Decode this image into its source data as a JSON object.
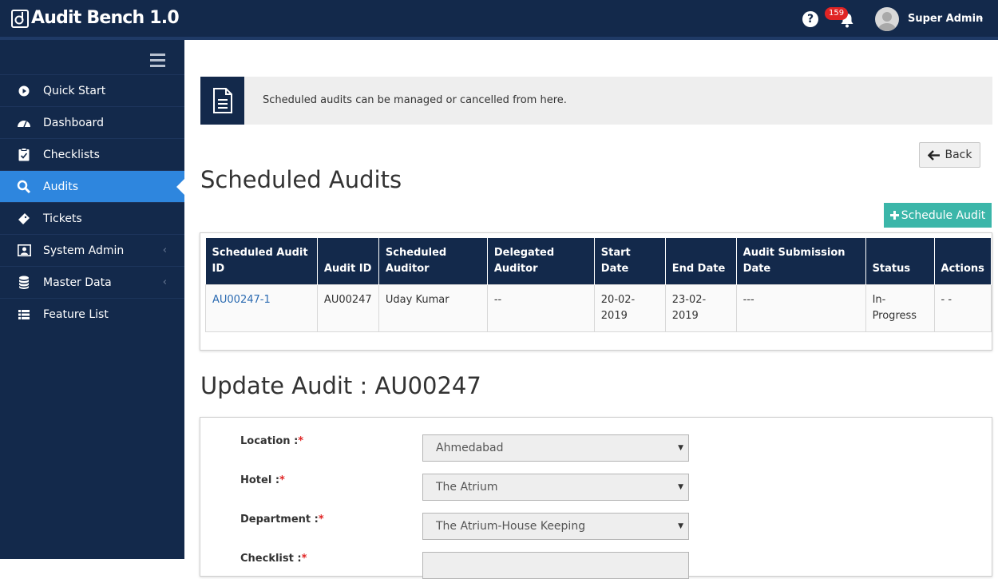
{
  "app": {
    "title": "Audit Bench 1.0"
  },
  "header": {
    "help_icon": "?",
    "notifications_count": "159",
    "user_name": "Super Admin",
    "user_caret": "⌄"
  },
  "sidebar": {
    "items": [
      {
        "label": "Quick Start",
        "icon": "play-circle-icon"
      },
      {
        "label": "Dashboard",
        "icon": "dashboard-icon"
      },
      {
        "label": "Checklists",
        "icon": "clipboard-icon"
      },
      {
        "label": "Audits",
        "icon": "search-icon",
        "active": true
      },
      {
        "label": "Tickets",
        "icon": "ticket-icon"
      },
      {
        "label": "System Admin",
        "icon": "admin-icon",
        "arrow": "‹"
      },
      {
        "label": "Master Data",
        "icon": "database-icon",
        "arrow": "‹"
      },
      {
        "label": "Feature List",
        "icon": "list-icon"
      }
    ]
  },
  "info": {
    "text": "Scheduled audits can be managed or cancelled from here."
  },
  "buttons": {
    "back": "Back",
    "schedule_audit": "Schedule Audit"
  },
  "page": {
    "title": "Scheduled Audits",
    "update_title": "Update Audit : AU00247"
  },
  "table": {
    "headers": [
      "Scheduled Audit ID",
      "Audit ID",
      "Scheduled Auditor",
      "Delegated Auditor",
      "Start Date",
      "End Date",
      "Audit Submission Date",
      "Status",
      "Actions"
    ],
    "rows": [
      [
        "AU00247-1",
        "AU00247",
        "Uday Kumar",
        "--",
        "20-02-2019",
        "23-02-2019",
        "---",
        "In-Progress",
        "- -"
      ]
    ]
  },
  "form": {
    "fields": [
      {
        "label": "Location :",
        "value": "Ahmedabad"
      },
      {
        "label": "Hotel :",
        "value": "The Atrium"
      },
      {
        "label": "Department :",
        "value": "The Atrium-House Keeping"
      },
      {
        "label": "Checklist :",
        "value": ""
      }
    ],
    "required_mark": "*"
  },
  "colors": {
    "navy": "#13294b",
    "accent_blue": "#2e86de",
    "teal": "#3bb6a9",
    "badge_red": "#e02424"
  }
}
